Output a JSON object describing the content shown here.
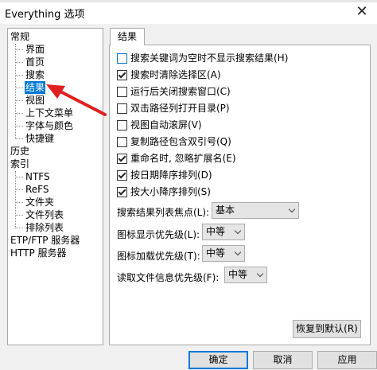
{
  "window": {
    "title": "Everything 选项",
    "close_glyph": "✕"
  },
  "tree": {
    "items": [
      {
        "label": "常规"
      },
      {
        "label": "界面"
      },
      {
        "label": "首页"
      },
      {
        "label": "搜索"
      },
      {
        "label": "结果"
      },
      {
        "label": "视图"
      },
      {
        "label": "上下文菜单"
      },
      {
        "label": "字体与颜色"
      },
      {
        "label": "快捷键"
      },
      {
        "label": "历史"
      },
      {
        "label": "索引"
      },
      {
        "label": "NTFS"
      },
      {
        "label": "ReFS"
      },
      {
        "label": "文件夹"
      },
      {
        "label": "文件列表"
      },
      {
        "label": "排除列表"
      },
      {
        "label": "ETP/FTP 服务器"
      },
      {
        "label": "HTTP 服务器"
      }
    ],
    "selected": "结果"
  },
  "tab": {
    "label": "结果"
  },
  "options": [
    {
      "label": "搜索关键词为空时不显示搜索结果(H)",
      "checked": false
    },
    {
      "label": "搜索时清除选择区(A)",
      "checked": true
    },
    {
      "label": "运行后关闭搜索窗口(C)",
      "checked": false
    },
    {
      "label": "双击路径列打开目录(P)",
      "checked": false
    },
    {
      "label": "视图自动滚屏(V)",
      "checked": false
    },
    {
      "label": "复制路径包含双引号(Q)",
      "checked": false
    },
    {
      "label": "重命名时, 忽略扩展名(E)",
      "checked": true
    },
    {
      "label": "按日期降序排列(D)",
      "checked": true
    },
    {
      "label": "按大小降序排列(S)",
      "checked": true
    }
  ],
  "dropdowns": {
    "focus": {
      "label": "搜索结果列表焦点(L):",
      "value": "基本"
    },
    "icon_display": {
      "label": "图标显示优先级(L):",
      "value": "中等"
    },
    "icon_load": {
      "label": "图标加载优先级(T):",
      "value": "中等"
    },
    "file_info": {
      "label": "读取文件信息优先级(F):",
      "value": "中等"
    }
  },
  "buttons": {
    "restore_defaults": "恢复到默认(R)",
    "ok": "确定",
    "cancel": "取消",
    "apply": "应用"
  },
  "colors": {
    "selection": "#0078d7",
    "annotation_arrow": "#e02020"
  }
}
